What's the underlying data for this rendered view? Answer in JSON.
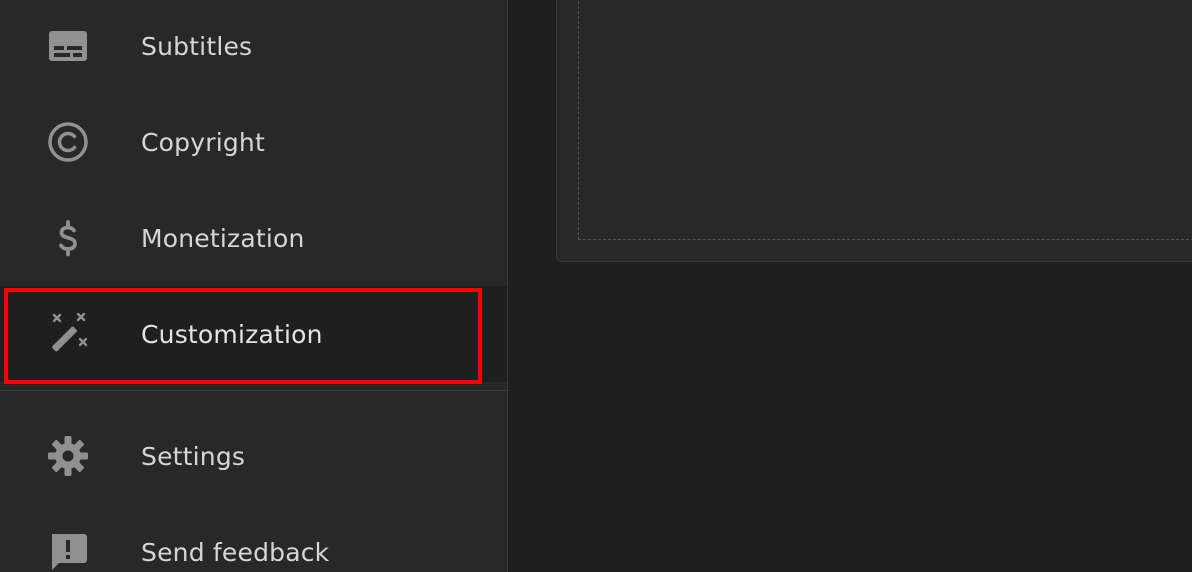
{
  "sidebar": {
    "items": [
      {
        "label": "Subtitles",
        "icon": "subtitles-icon"
      },
      {
        "label": "Copyright",
        "icon": "copyright-icon"
      },
      {
        "label": "Monetization",
        "icon": "dollar-icon"
      },
      {
        "label": "Customization",
        "icon": "magic-wand-icon",
        "active": true
      },
      {
        "label": "Settings",
        "icon": "gear-icon"
      },
      {
        "label": "Send feedback",
        "icon": "feedback-icon"
      }
    ]
  },
  "colors": {
    "sidebar_bg": "#282828",
    "main_bg": "#1f1f1f",
    "icon": "#909090",
    "text": "#d6d6d6",
    "highlight": "#ff0000"
  }
}
